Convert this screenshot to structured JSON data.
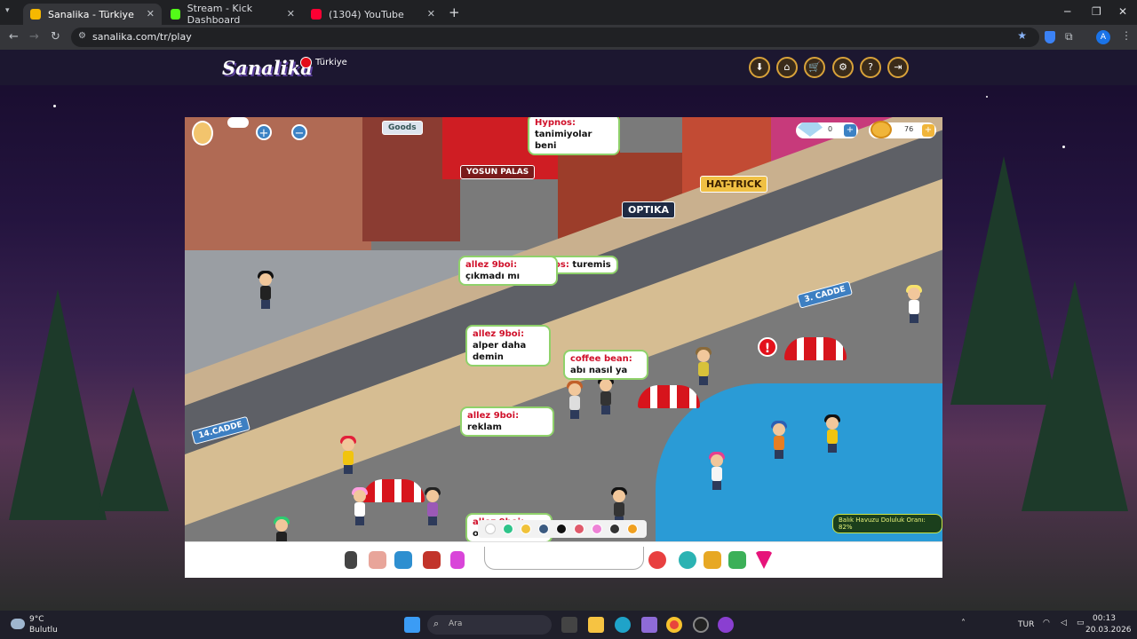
{
  "browser": {
    "tabs": [
      {
        "title": "Sanalika - Türkiye",
        "active": true,
        "icon": "sanalika-favicon"
      },
      {
        "title": "Stream - Kick Dashboard",
        "active": false,
        "icon": "kick-favicon"
      },
      {
        "title": "(1304) YouTube",
        "active": false,
        "icon": "youtube-favicon"
      }
    ],
    "new_tab": "+",
    "url": "sanalika.com/tr/play",
    "profile_initial": "A"
  },
  "site": {
    "logo": "Sanalika",
    "region": "Türkiye",
    "header_buttons": [
      "download-icon",
      "home-icon",
      "cart-icon",
      "gear-icon",
      "help-icon",
      "logout-icon"
    ]
  },
  "game": {
    "diamonds": "0",
    "coins": "76",
    "chat_bubbles": [
      {
        "user": "Hypnos:",
        "text": "tanimiyolar beni"
      },
      {
        "user": "allez 9boi:",
        "text": "çıkmadı mı"
      },
      {
        "user": "os:",
        "text": "turemis"
      },
      {
        "user": "allez 9boi:",
        "text": "alper daha demin"
      },
      {
        "user": "coffee bean:",
        "text": "abı nasıl ya"
      },
      {
        "user": "allez 9boi:",
        "text": "reklam"
      },
      {
        "user": "allez 9boi:",
        "text": "olum"
      }
    ],
    "signs": {
      "left_street": "14.CADDE",
      "right_street": "3. CADDE",
      "shop1": "Goods",
      "shop2": "YOSUN PALAS",
      "shop3": "OPTIKA",
      "shop4": "HAT-TRICK"
    },
    "fill_status": "Balık Havuzu Doluluk Oranı: 82%",
    "fill_percent": 82,
    "chat_colors": [
      "#ffffff",
      "#2fc48a",
      "#f0c23a",
      "#3b5a80",
      "#111111",
      "#e05a6b",
      "#ee82d6",
      "#333333",
      "#f0a020"
    ],
    "toolbar_left": [
      "phone-icon",
      "shoes-icon",
      "hat-icon",
      "bag-icon",
      "dance-icon"
    ],
    "toolbar_right": [
      "chat-bubble-icon",
      "pet-icon",
      "trophy-icon",
      "island-icon",
      "menu-arrow-icon"
    ]
  },
  "taskbar": {
    "weather_temp": "9°C",
    "weather_desc": "Bulutlu",
    "search_placeholder": "Ara",
    "lang": "TUR",
    "time": "00:13",
    "date": "20.03.2026"
  }
}
